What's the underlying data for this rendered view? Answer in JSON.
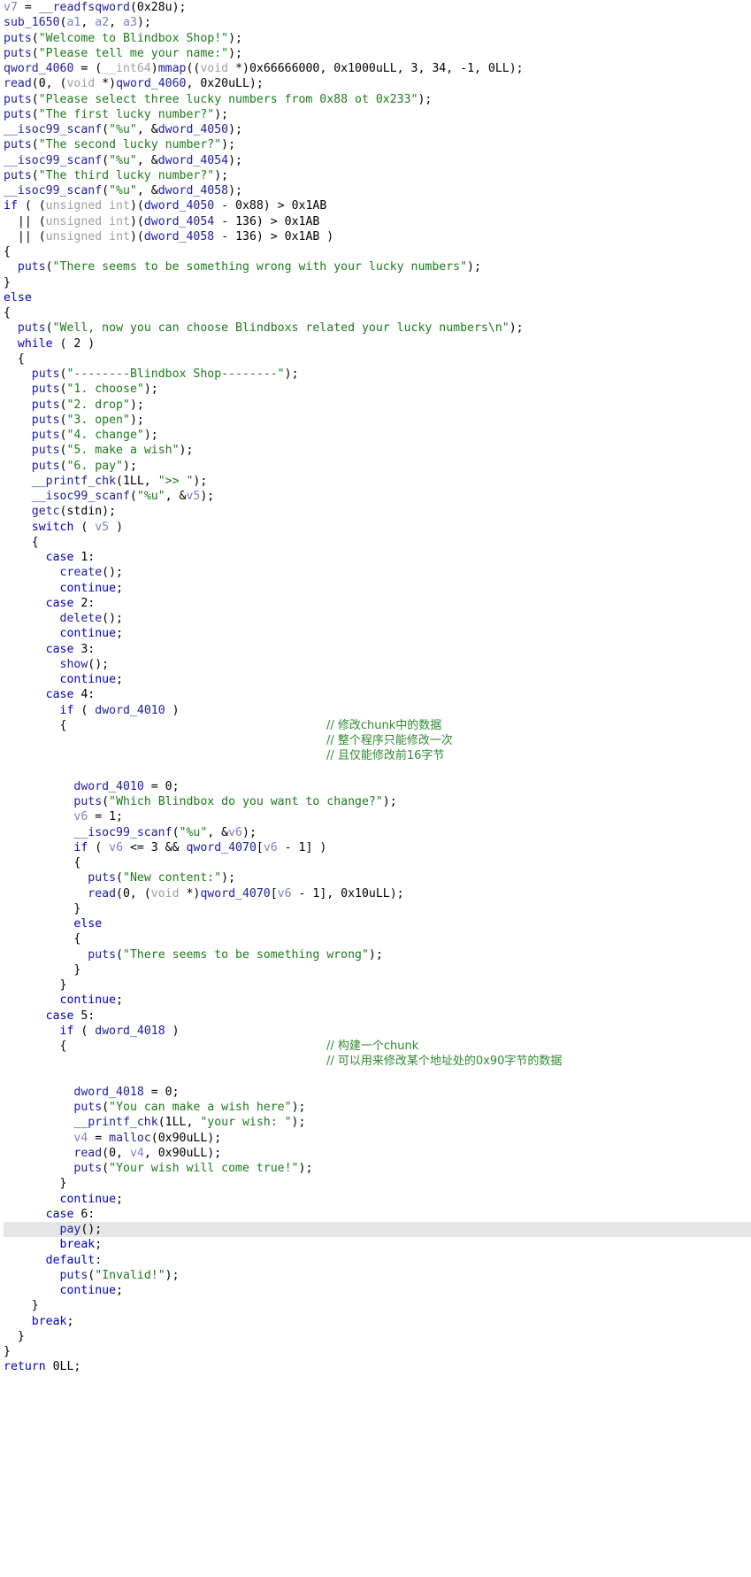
{
  "view": {
    "title": "IDA Pseudocode",
    "background_color": "#ffffff",
    "highlight_color": "#e6e6e6",
    "colors": {
      "keyword": "#0000c0",
      "function": "#2020a0",
      "string": "#1e7a1e",
      "comment": "#2e8b2e",
      "local_var": "#8080c0",
      "type_cast": "#a0a0a0",
      "global_var": "#2020a0",
      "text": "#000000"
    }
  },
  "code": {
    "language": "c-pseudocode",
    "lines": [
      "v7 = __readfsqword(0x28u);",
      "sub_1650(a1, a2, a3);",
      "puts(\"Welcome to Blindbox Shop!\");",
      "puts(\"Please tell me your name:\");",
      "qword_4060 = (__int64)mmap((void *)0x66666000, 0x1000uLL, 3, 34, -1, 0LL);",
      "read(0, (void *)qword_4060, 0x20uLL);",
      "puts(\"Please select three lucky numbers from 0x88 ot 0x233\");",
      "puts(\"The first lucky number?\");",
      "__isoc99_scanf(\"%u\", &dword_4050);",
      "puts(\"The second lucky number?\");",
      "__isoc99_scanf(\"%u\", &dword_4054);",
      "puts(\"The third lucky number?\");",
      "__isoc99_scanf(\"%u\", &dword_4058);",
      "if ( (unsigned int)(dword_4050 - 0x88) > 0x1AB",
      "  || (unsigned int)(dword_4054 - 136) > 0x1AB",
      "  || (unsigned int)(dword_4058 - 136) > 0x1AB )",
      "{",
      "  puts(\"There seems to be something wrong with your lucky numbers\");",
      "}",
      "else",
      "{",
      "  puts(\"Well, now you can choose Blindboxs related your lucky numbers\\n\");",
      "  while ( 2 )",
      "  {",
      "    puts(\"--------Blindbox Shop--------\");",
      "    puts(\"1. choose\");",
      "    puts(\"2. drop\");",
      "    puts(\"3. open\");",
      "    puts(\"4. change\");",
      "    puts(\"5. make a wish\");",
      "    puts(\"6. pay\");",
      "    __printf_chk(1LL, \">> \");",
      "    __isoc99_scanf(\"%u\", &v5);",
      "    getc(stdin);",
      "    switch ( v5 )",
      "    {",
      "      case 1:",
      "        create();",
      "        continue;",
      "      case 2:",
      "        delete();",
      "        continue;",
      "      case 3:",
      "        show();",
      "        continue;",
      "      case 4:",
      "        if ( dword_4010 )",
      "        {",
      "          dword_4010 = 0;",
      "          puts(\"Which Blindbox do you want to change?\");",
      "          v6 = 1;",
      "          __isoc99_scanf(\"%u\", &v6);",
      "          if ( v6 <= 3 && qword_4070[v6 - 1] )",
      "          {",
      "            puts(\"New content:\");",
      "            read(0, (void *)qword_4070[v6 - 1], 0x10uLL);",
      "          }",
      "          else",
      "          {",
      "            puts(\"There seems to be something wrong\");",
      "          }",
      "        }",
      "        continue;",
      "      case 5:",
      "        if ( dword_4018 )",
      "        {",
      "          dword_4018 = 0;",
      "          puts(\"You can make a wish here\");",
      "          __printf_chk(1LL, \"your wish: \");",
      "          v4 = malloc(0x90uLL);",
      "          read(0, v4, 0x90uLL);",
      "          puts(\"Your wish will come true!\");",
      "        }",
      "        continue;",
      "      case 6:",
      "        pay();",
      "        break;",
      "      default:",
      "        puts(\"Invalid!\");",
      "        continue;",
      "    }",
      "    break;",
      "  }",
      "}",
      "return 0LL;"
    ]
  },
  "comments": {
    "group_1": [
      "// 修改chunk中的数据",
      "// 整个程序只能修改一次",
      "// 且仅能修改前16字节"
    ],
    "group_2": [
      "// 构建一个chunk",
      "// 可以用来修改某个地址处的0x90字节的数据"
    ]
  },
  "highlighted_line": {
    "index": 74,
    "text": "pay();"
  },
  "strings": [
    "Welcome to Blindbox Shop!",
    "Please tell me your name:",
    "Please select three lucky numbers from 0x88 ot 0x233",
    "The first lucky number?",
    "The second lucky number?",
    "The third lucky number?",
    "There seems to be something wrong with your lucky numbers",
    "Well, now you can choose Blindboxs related your lucky numbers\\n",
    "--------Blindbox Shop--------",
    "1. choose",
    "2. drop",
    "3. open",
    "4. change",
    "5. make a wish",
    "6. pay",
    ">> ",
    "%u",
    "Which Blindbox do you want to change?",
    "New content:",
    "There seems to be something wrong",
    "You can make a wish here",
    "your wish: ",
    "Your wish will come true!",
    "Invalid!"
  ],
  "globals": [
    "qword_4060",
    "dword_4050",
    "dword_4054",
    "dword_4058",
    "dword_4010",
    "dword_4018",
    "qword_4070"
  ],
  "locals": [
    "v4",
    "v5",
    "v6",
    "v7"
  ],
  "args": [
    "a1",
    "a2",
    "a3"
  ],
  "functions": [
    "__readfsqword",
    "sub_1650",
    "puts",
    "mmap",
    "read",
    "__isoc99_scanf",
    "__printf_chk",
    "getc",
    "create",
    "delete",
    "show",
    "malloc",
    "pay"
  ]
}
